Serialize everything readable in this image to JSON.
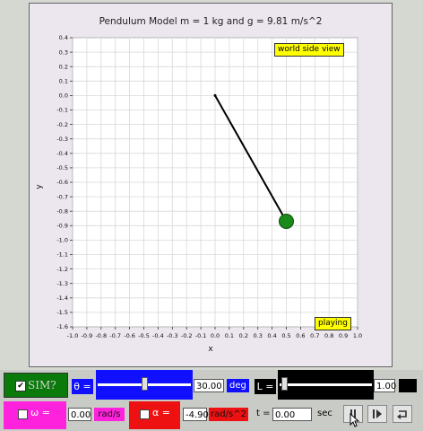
{
  "plot": {
    "title": "Pendulum Model  m = 1 kg and g = 9.81 m/s^2",
    "view_tag": "world side view",
    "status_tag": "playing",
    "xlabel": "x",
    "ylabel": "y",
    "xlim": [
      -1.0,
      1.0
    ],
    "ylim": [
      -1.6,
      0.4
    ],
    "x_ticks": [
      "-1.0",
      "-0.9",
      "-0.8",
      "-0.7",
      "-0.6",
      "-0.5",
      "-0.4",
      "-0.3",
      "-0.2",
      "-0.1",
      "0.0",
      "0.1",
      "0.2",
      "0.3",
      "0.4",
      "0.5",
      "0.6",
      "0.7",
      "0.8",
      "0.9",
      "1.0"
    ],
    "y_ticks": [
      "0.4",
      "0.3",
      "0.2",
      "0.1",
      "0.0",
      "-0.1",
      "-0.2",
      "-0.3",
      "-0.4",
      "-0.5",
      "-0.6",
      "-0.7",
      "-0.8",
      "-0.9",
      "-1.0",
      "-1.1",
      "-1.2",
      "-1.3",
      "-1.4",
      "-1.5",
      "-1.6"
    ],
    "pivot": [
      0.0,
      0.0
    ],
    "bob": [
      0.5,
      -0.87
    ],
    "rod_color": "#000000",
    "bob_color": "#1a8a1a",
    "grid": true
  },
  "controls": {
    "sim_label": "SIM?",
    "sim_checked": true,
    "theta_label": "θ =",
    "theta_value": "30.00",
    "theta_unit": "deg",
    "theta_slider_fraction": 0.5,
    "length_label": "L =",
    "length_value": "1.00",
    "length_slider_fraction": 0.02,
    "omega_label": "ω =",
    "omega_value": "0.00",
    "omega_unit": "rad/s",
    "alpha_label": "α =",
    "alpha_value": "-4.90",
    "alpha_unit": "rad/s^2",
    "time_label": "t =",
    "time_value": "0.00",
    "time_unit": "sec",
    "pause_icon": "pause-icon",
    "step_icon": "step-forward-icon",
    "reset_icon": "reset-icon",
    "colors": {
      "sim_bg": "#0a7a0a",
      "slider_blue": "#1010ff",
      "magenta": "#ff22dd",
      "red": "#ee1111"
    }
  }
}
